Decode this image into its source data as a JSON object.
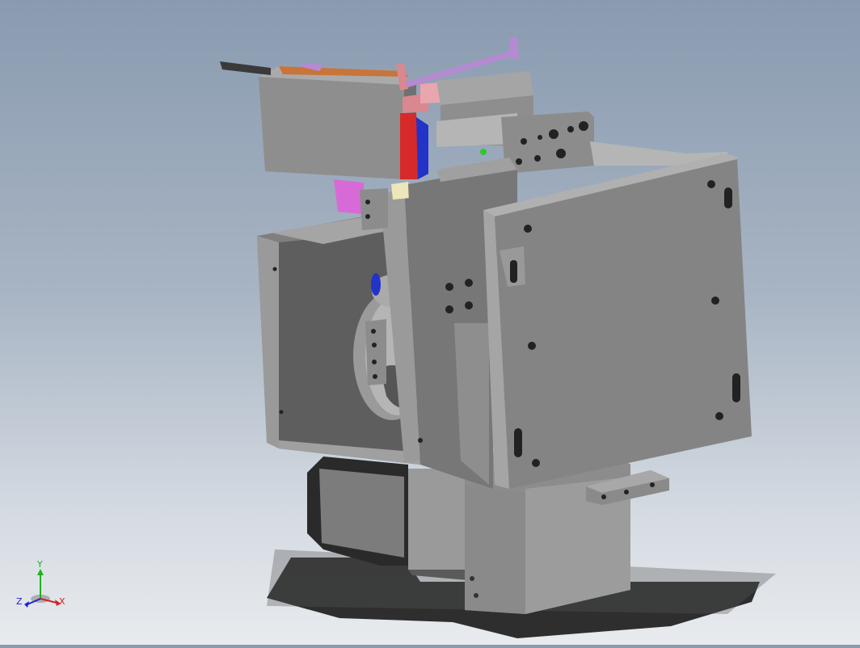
{
  "viewport": {
    "background_top": "#8a9bb0",
    "background_bottom": "#e8ebee"
  },
  "model": {
    "part_color": "#8f8f8f",
    "highlight_colors": {
      "red": "#d62a2a",
      "blue": "#2233c8",
      "pink": "#e8a6ae",
      "magenta": "#d86ad8",
      "orange": "#c8743a",
      "green": "#2ec82e",
      "lavender": "#b58ad0",
      "cream": "#ece6b8"
    }
  },
  "triad": {
    "x_label": "X",
    "y_label": "Y",
    "z_label": "Z",
    "x_color": "#d42020",
    "y_color": "#20b020",
    "z_color": "#2020d0"
  }
}
